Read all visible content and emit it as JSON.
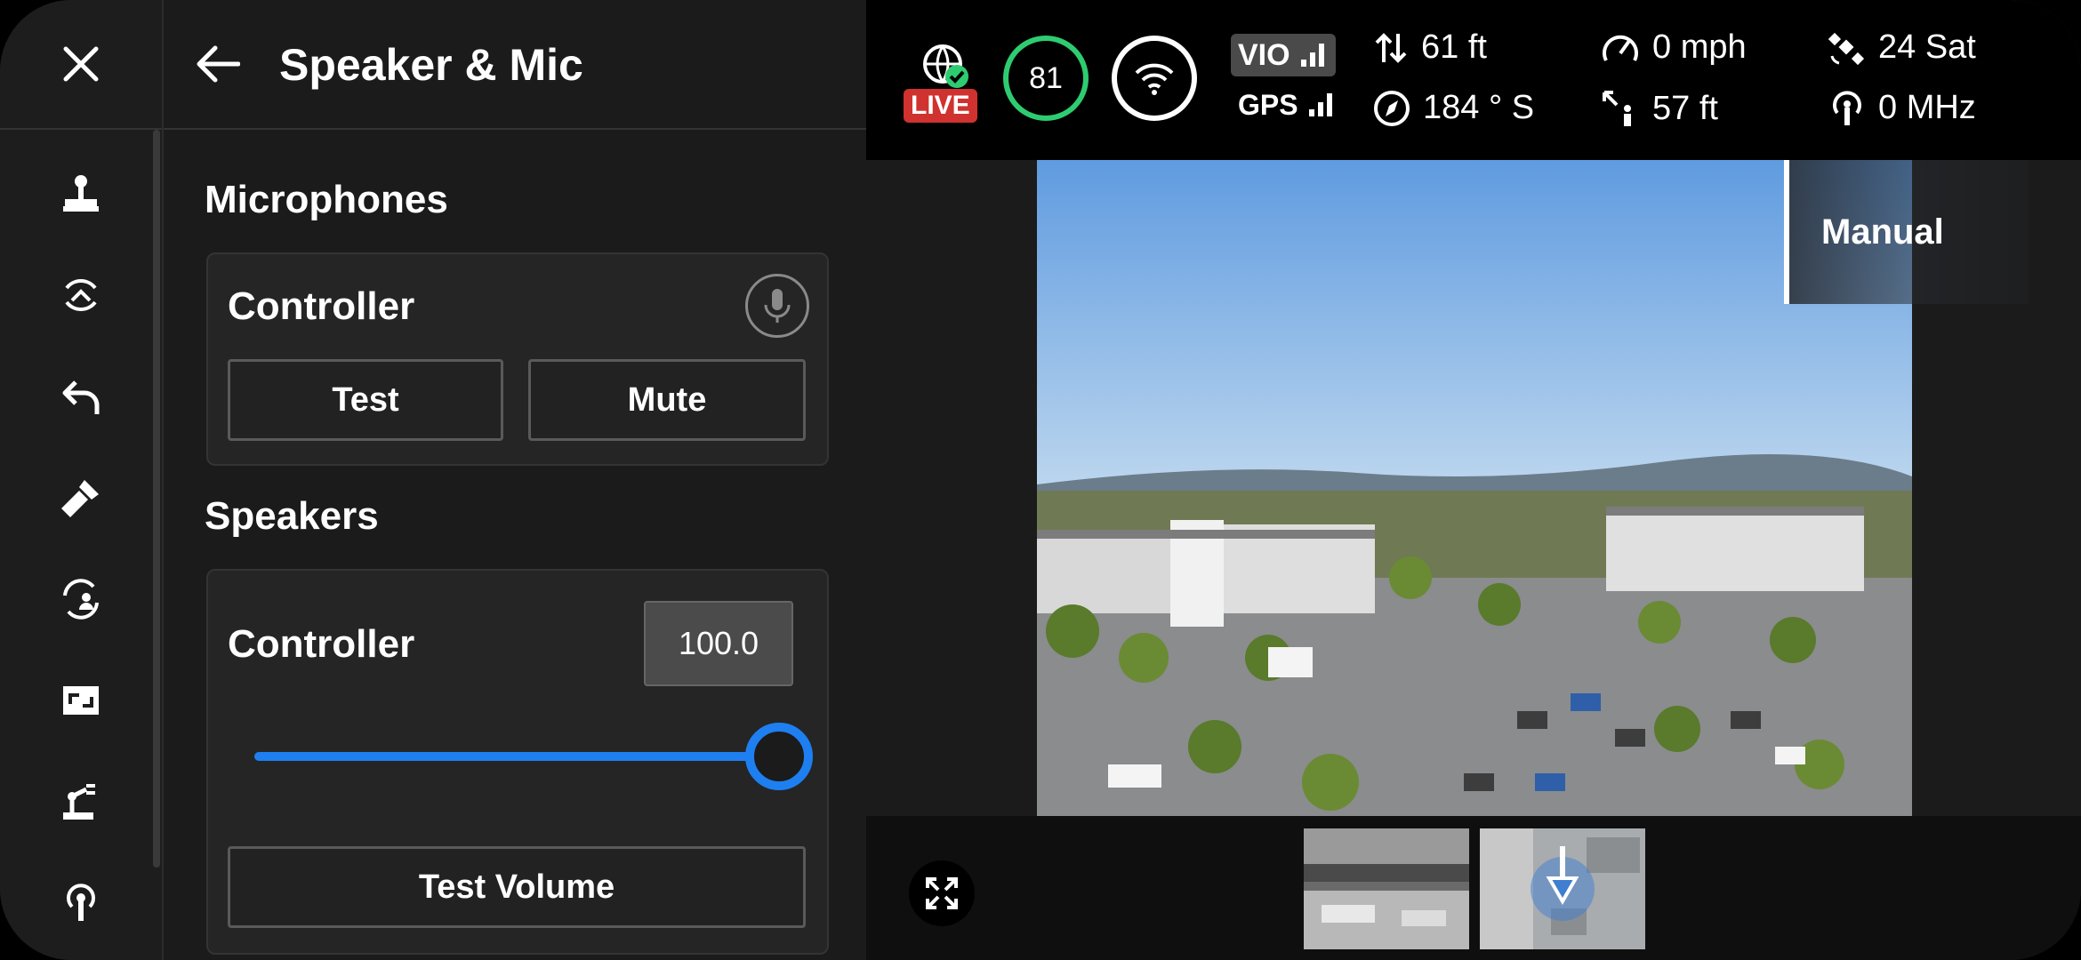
{
  "panel": {
    "title": "Speaker & Mic",
    "microphones_title": "Microphones",
    "speakers_title": "Speakers",
    "mic_card": {
      "title": "Controller",
      "test_label": "Test",
      "mute_label": "Mute"
    },
    "speaker_card": {
      "title": "Controller",
      "volume_value": "100.0",
      "volume_fraction": 1.0,
      "test_volume_label": "Test Volume"
    }
  },
  "rail": {
    "icons": [
      "close-icon",
      "joystick-icon",
      "gimbal-icon",
      "return-icon",
      "flashlight-icon",
      "user-sync-icon",
      "aspect-ratio-icon",
      "robot-arm-icon",
      "antenna-icon"
    ]
  },
  "telemetry": {
    "live_label": "LIVE",
    "battery_value": "81",
    "vio_label": "VIO",
    "gps_label": "GPS",
    "altitude": "61 ft",
    "heading": "184 ° S",
    "speed": "0 mph",
    "distance": "57 ft",
    "satellites": "24 Sat",
    "frequency": "0 MHz"
  },
  "video": {
    "mode_label": "Manual"
  },
  "colors": {
    "accent": "#1e7ff0",
    "live_red": "#d0322f",
    "battery_green": "#2ecc71"
  }
}
